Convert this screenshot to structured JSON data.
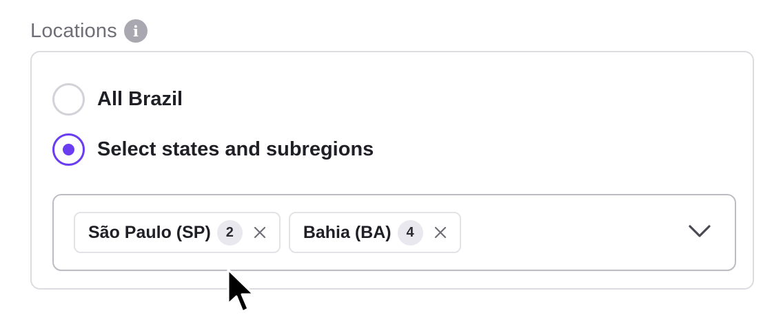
{
  "section": {
    "label": "Locations",
    "info_icon": "info-icon"
  },
  "options": [
    {
      "label": "All Brazil",
      "selected": false
    },
    {
      "label": "Select states and subregions",
      "selected": true
    }
  ],
  "multiselect": {
    "chips": [
      {
        "label": "São Paulo (SP)",
        "count": "2",
        "remove_icon": "close-icon"
      },
      {
        "label": "Bahia (BA)",
        "count": "4",
        "remove_icon": "close-icon"
      }
    ],
    "dropdown_icon": "chevron-down-icon"
  },
  "colors": {
    "accent": "#6a3df0",
    "label_gray": "#6f6e77",
    "border": "#dcdbe0",
    "info_icon_bg": "#a9a8b0",
    "chip_count_bg": "#e9e8ee"
  },
  "cursor_icon": "mouse-pointer-icon"
}
